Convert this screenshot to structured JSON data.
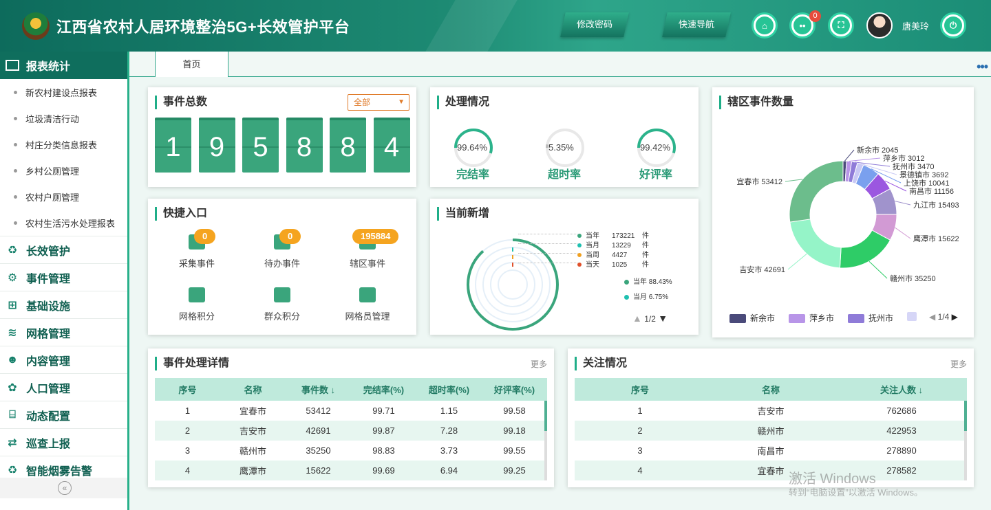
{
  "header": {
    "title": "江西省农村人居环境整治5G+长效管护平台",
    "change_password": "修改密码",
    "quick_nav": "快速导航",
    "notification_count": "0",
    "username": "唐美玲"
  },
  "sidebar": {
    "section_title": "报表统计",
    "sub_items": [
      "新农村建设点报表",
      "垃圾清洁行动",
      "村庄分类信息报表",
      "乡村公厕管理",
      "农村户厕管理",
      "农村生活污水处理报表"
    ],
    "menu_items": [
      {
        "label": "长效管护",
        "icon": "recycle-icon"
      },
      {
        "label": "事件管理",
        "icon": "event-icon"
      },
      {
        "label": "基础设施",
        "icon": "grid-icon"
      },
      {
        "label": "网格管理",
        "icon": "layers-icon"
      },
      {
        "label": "内容管理",
        "icon": "person-icon"
      },
      {
        "label": "人口管理",
        "icon": "gear-icon"
      },
      {
        "label": "动态配置",
        "icon": "map-icon"
      },
      {
        "label": "巡查上报",
        "icon": "swap-icon"
      },
      {
        "label": "智能烟雾告警",
        "icon": "recycle-icon"
      }
    ],
    "collapse_glyph": "«"
  },
  "tabs": {
    "home": "首页",
    "more": "•••"
  },
  "event_total": {
    "title": "事件总数",
    "filter": "全部",
    "digits": [
      "1",
      "9",
      "5",
      "8",
      "8",
      "4"
    ]
  },
  "processing": {
    "title": "处理情况",
    "rings": [
      {
        "pct": "99.64%",
        "label": "完结率",
        "value": 99.64,
        "color": "#2bb38b"
      },
      {
        "pct": "5.35%",
        "label": "超时率",
        "value": 5.35,
        "color": "#bbbbbb"
      },
      {
        "pct": "99.42%",
        "label": "好评率",
        "value": 99.42,
        "color": "#2bb38b"
      }
    ]
  },
  "quick_entry": {
    "title": "快捷入口",
    "items": [
      {
        "label": "采集事件",
        "badge": "0"
      },
      {
        "label": "待办事件",
        "badge": "0"
      },
      {
        "label": "辖区事件",
        "badge": "195884"
      },
      {
        "label": "网格积分",
        "badge": ""
      },
      {
        "label": "群众积分",
        "badge": ""
      },
      {
        "label": "网格员管理",
        "badge": ""
      }
    ]
  },
  "new_added": {
    "title": "当前新增",
    "rows": [
      {
        "name": "当年",
        "value": "173221",
        "unit": "件",
        "color": "#3aa57c"
      },
      {
        "name": "当月",
        "value": "13229",
        "unit": "件",
        "color": "#1fc0b0"
      },
      {
        "name": "当周",
        "value": "4427",
        "unit": "件",
        "color": "#f0a020"
      },
      {
        "name": "当天",
        "value": "1025",
        "unit": "件",
        "color": "#e0502a"
      }
    ],
    "legend": [
      {
        "label": "当年 88.43%",
        "color": "#3aa57c"
      },
      {
        "label": "当月 6.75%",
        "color": "#1fc0b0"
      }
    ],
    "pager": "1/2"
  },
  "district": {
    "title": "辖区事件数量",
    "chart_data": {
      "type": "pie",
      "labels": [
        "新余市",
        "萍乡市",
        "抚州市",
        "景德镇市",
        "上饶市",
        "南昌市",
        "九江市",
        "鹰潭市",
        "赣州市",
        "吉安市",
        "宜春市"
      ],
      "values": [
        2045,
        3012,
        3470,
        3692,
        10041,
        11156,
        15493,
        15622,
        35250,
        42691,
        53412
      ],
      "colors": [
        "#4a4a7a",
        "#b895e8",
        "#8f7bd8",
        "#c9c9f5",
        "#7aa0ee",
        "#9b57e0",
        "#a093cc",
        "#d29ad4",
        "#2ecc67",
        "#95f4c8",
        "#6cbd8c"
      ],
      "label_text": [
        "新余市 2045",
        "萍乡市 3012",
        "抚州市 3470",
        "景德镇市 3692",
        "上饶市 10041",
        "南昌市 11156",
        "九江市 15493",
        "鹰潭市 15622",
        "赣州市 35250",
        "吉安市 42691",
        "宜春市 53412"
      ]
    },
    "legend": [
      {
        "label": "新余市",
        "color": "#4a4a7a"
      },
      {
        "label": "萍乡市",
        "color": "#b895e8"
      },
      {
        "label": "抚州市",
        "color": "#8f7bd8"
      }
    ],
    "pager": "1/4"
  },
  "detail_table": {
    "title": "事件处理详情",
    "more": "更多",
    "headers": [
      "序号",
      "名称",
      "事件数 ↓",
      "完结率(%)",
      "超时率(%)",
      "好评率(%)"
    ],
    "rows": [
      [
        "1",
        "宜春市",
        "53412",
        "99.71",
        "1.15",
        "99.58"
      ],
      [
        "2",
        "吉安市",
        "42691",
        "99.87",
        "7.28",
        "99.18"
      ],
      [
        "3",
        "赣州市",
        "35250",
        "98.83",
        "3.73",
        "99.55"
      ],
      [
        "4",
        "鹰潭市",
        "15622",
        "99.69",
        "6.94",
        "99.25"
      ]
    ]
  },
  "attention_table": {
    "title": "关注情况",
    "more": "更多",
    "headers": [
      "序号",
      "名称",
      "关注人数 ↓"
    ],
    "rows": [
      [
        "1",
        "吉安市",
        "762686"
      ],
      [
        "2",
        "赣州市",
        "422953"
      ],
      [
        "3",
        "南昌市",
        "278890"
      ],
      [
        "4",
        "宜春市",
        "278582"
      ]
    ]
  },
  "watermark": {
    "line1": "激活 Windows",
    "line2": "转到“电脑设置”以激活 Windows。"
  }
}
